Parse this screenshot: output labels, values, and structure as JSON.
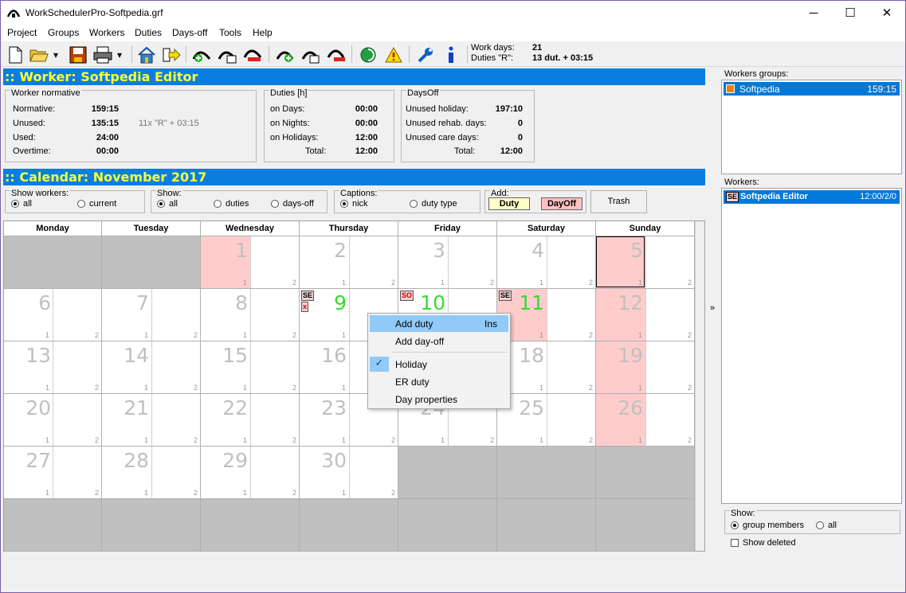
{
  "window": {
    "title": "WorkSchedulerPro-Softpedia.grf"
  },
  "menu": [
    "Project",
    "Groups",
    "Workers",
    "Duties",
    "Days-off",
    "Tools",
    "Help"
  ],
  "toolbar_info": {
    "work_days_label": "Work days:",
    "work_days_value": "21",
    "duties_label": "Duties \"R\":",
    "duties_value": "13 dut. + 03:15"
  },
  "worker": {
    "header": ":: Worker: Softpedia Editor",
    "normative_title": "Worker normative",
    "normative_label": "Normative:",
    "normative_value": "159:15",
    "unused_label": "Unused:",
    "unused_value": "135:15",
    "unused_note": "11x \"R\" + 03:15",
    "used_label": "Used:",
    "used_value": "24:00",
    "overtime_label": "Overtime:",
    "overtime_value": "00:00",
    "duties_title": "Duties [h]",
    "on_days_label": "on Days:",
    "on_days_value": "00:00",
    "on_nights_label": "on Nights:",
    "on_nights_value": "00:00",
    "on_holidays_label": "on Holidays:",
    "on_holidays_value": "12:00",
    "duties_total_label": "Total:",
    "duties_total_value": "12:00",
    "daysoff_title": "DaysOff",
    "unused_holiday_label": "Unused holiday:",
    "unused_holiday_value": "197:10",
    "rehab_label": "Unused rehab. days:",
    "rehab_value": "0",
    "care_label": "Unused care days:",
    "care_value": "0",
    "daysoff_total_label": "Total:",
    "daysoff_total_value": "12:00"
  },
  "calendar": {
    "header": ":: Calendar: November 2017",
    "show_workers": {
      "title": "Show workers:",
      "all": "all",
      "current": "current"
    },
    "show": {
      "title": "Show:",
      "all": "all",
      "duties": "duties",
      "daysoff": "days-off"
    },
    "captions": {
      "title": "Captions:",
      "nick": "nick",
      "duty_type": "duty type"
    },
    "add": {
      "title": "Add:",
      "duty": "Duty",
      "dayoff": "DayOff"
    },
    "trash": "Trash",
    "days": [
      "Monday",
      "Tuesday",
      "Wednesday",
      "Thursday",
      "Friday",
      "Saturday",
      "Sunday"
    ],
    "cells": [
      [
        "",
        "",
        "1",
        "2",
        "3",
        "4",
        "5"
      ],
      [
        "6",
        "7",
        "8",
        "9",
        "10",
        "11",
        "12"
      ],
      [
        "13",
        "14",
        "15",
        "16",
        "17",
        "18",
        "19"
      ],
      [
        "20",
        "21",
        "22",
        "23",
        "24",
        "25",
        "26"
      ],
      [
        "27",
        "28",
        "29",
        "30",
        "",
        "",
        ""
      ],
      [
        "",
        "",
        "",
        "",
        "",
        "",
        ""
      ]
    ],
    "slot1": "1",
    "slot2": "2",
    "badges": {
      "thu9_a": "SE",
      "thu9_b": "x",
      "fri10": "SO",
      "sat11": "SE"
    },
    "colors": {
      "holiday": "#ffcccc",
      "inactive": "#c0c0c0",
      "green_day": "#33dd33"
    }
  },
  "context_menu": {
    "add_duty": "Add duty",
    "add_duty_shortcut": "Ins",
    "add_dayoff": "Add day-off",
    "holiday": "Holiday",
    "er_duty": "ER duty",
    "day_properties": "Day properties"
  },
  "right_panel": {
    "groups_title": "Workers groups:",
    "group_name": "Softpedia",
    "group_value": "159:15",
    "workers_title": "Workers:",
    "worker_badge": "SE",
    "worker_name": "Softpedia Editor",
    "worker_value": "12:00/2/0",
    "show_title": "Show:",
    "group_members": "group members",
    "all": "all",
    "show_deleted": "Show deleted"
  },
  "splitter_glyph": "»"
}
